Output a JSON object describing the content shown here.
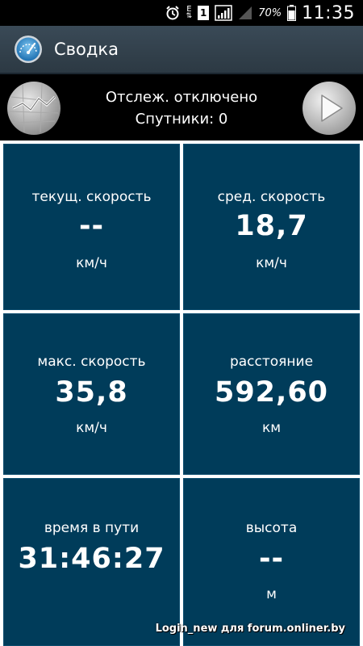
{
  "status_bar": {
    "battery": "70%",
    "time": "11:35",
    "sim_label": "1",
    "network_label": "E"
  },
  "app_bar": {
    "title": "Сводка",
    "logo_icon": "speedometer-icon"
  },
  "tracking": {
    "status": "Отслеж. отключено",
    "satellites": "Спутники: 0",
    "map_icon": "map-route-icon",
    "play_icon": "play-icon"
  },
  "tiles": [
    {
      "label": "текущ. скорость",
      "value": "--",
      "unit": "км/ч"
    },
    {
      "label": "сред. скорость",
      "value": "18,7",
      "unit": "км/ч"
    },
    {
      "label": "макс. скорость",
      "value": "35,8",
      "unit": "км/ч"
    },
    {
      "label": "расстояние",
      "value": "592,60",
      "unit": "км"
    },
    {
      "label": "время в пути",
      "value": "31:46:27",
      "unit": ""
    },
    {
      "label": "высота",
      "value": "--",
      "unit": "м"
    }
  ],
  "watermark": "Login_new для forum.onliner.by",
  "colors": {
    "tile_bg": "#003c5a",
    "grid_lines": "#ffffff",
    "appbar_bg": "#34434f"
  }
}
